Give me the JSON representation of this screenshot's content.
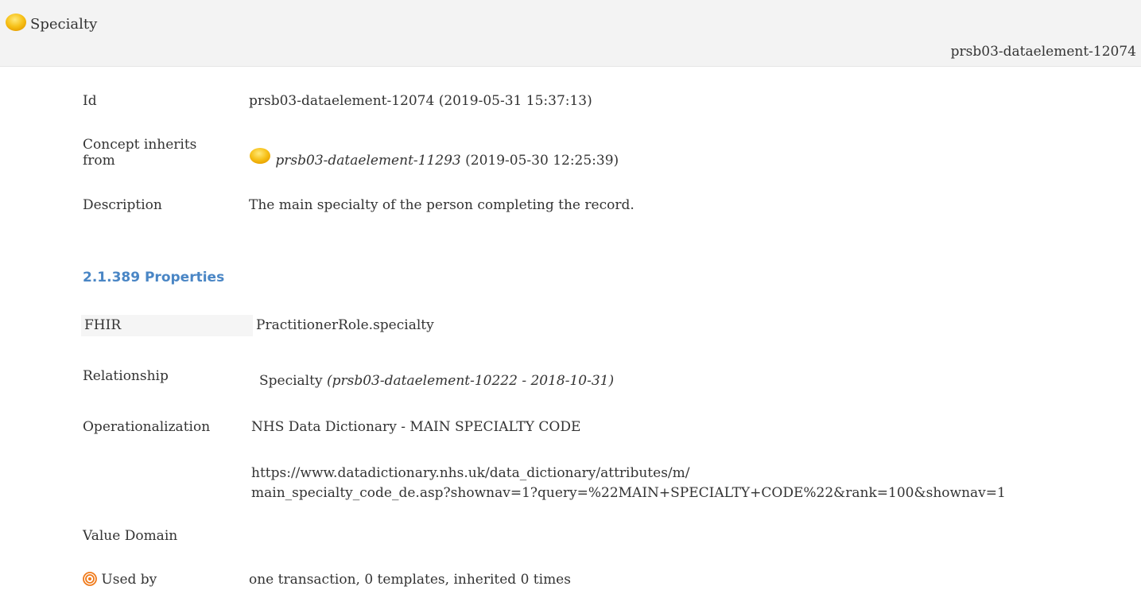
{
  "header": {
    "title": "Specialty",
    "concept_id": "prsb03-dataelement-12074",
    "icon": "yellow-circle-icon",
    "icon_color": "#f5b800"
  },
  "details": {
    "id_label": "Id",
    "id_value": "prsb03-dataelement-12074 (2019-05-31 15:37:13)",
    "inherits_label_line1": "Concept inherits",
    "inherits_label_line2": "from",
    "inherits_ref": "prsb03-dataelement-11293",
    "inherits_date": "(2019-05-30 12:25:39)",
    "description_label": "Description",
    "description_value": "The main specialty of the person completing the record."
  },
  "properties": {
    "heading": "2.1.389 Properties",
    "heading_color": "#4a86c5",
    "fhir_label": "FHIR",
    "fhir_value": "PractitionerRole.specialty",
    "relationship_label": "Relationship",
    "relationship_name": "Specialty",
    "relationship_ref": "(prsb03-dataelement-10222 - 2018-10-31)",
    "operationalization_label": "Operationalization",
    "operationalization_value": "NHS Data Dictionary - MAIN SPECIALTY CODE",
    "operationalization_url_line1": "https://www.datadictionary.nhs.uk/data_dictionary/attributes/m/",
    "operationalization_url_line2": "main_specialty_code_de.asp?shownav=1?query=%22MAIN+SPECIALTY+CODE%22&rank=100&shownav=1",
    "value_domain_label": "Value Domain",
    "used_by_label": "Used by",
    "used_by_icon": "target-icon",
    "used_by_icon_color": "#f07a1a",
    "used_by_value": "one transaction, 0 templates, inherited 0 times"
  }
}
